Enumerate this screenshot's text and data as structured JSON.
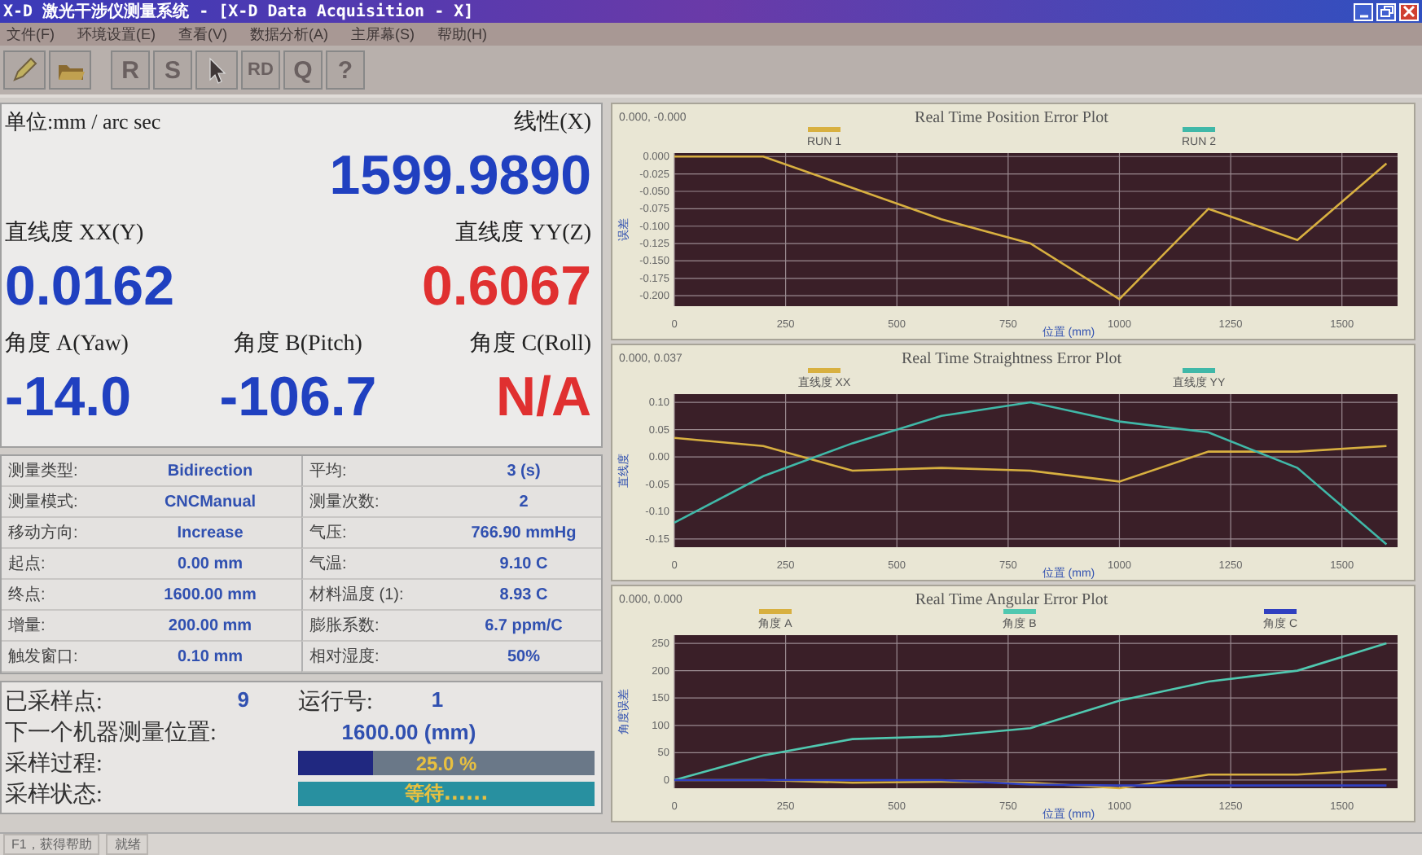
{
  "window": {
    "title": "X-D 激光干涉仪测量系统 - [X-D Data Acquisition - X]"
  },
  "menu": [
    "文件(F)",
    "环境设置(E)",
    "查看(V)",
    "数据分析(A)",
    "主屏幕(S)",
    "帮助(H)"
  ],
  "toolbar": [
    {
      "kind": "icon"
    },
    {
      "kind": "icon"
    },
    {
      "kind": "text",
      "label": "R"
    },
    {
      "kind": "text",
      "label": "S"
    },
    {
      "kind": "icon"
    },
    {
      "kind": "text",
      "label": "RD"
    },
    {
      "kind": "text",
      "label": "Q"
    },
    {
      "kind": "text",
      "label": "?"
    }
  ],
  "readouts": {
    "unit": "单位:mm / arc sec",
    "items": [
      {
        "label": "线性(X)",
        "value": "1599.9890",
        "color": "#2040c0"
      },
      {
        "label": "直线度 XX(Y)",
        "value": "0.0162",
        "color": "#2040c0"
      },
      {
        "label": "直线度 YY(Z)",
        "value": "0.6067",
        "color": "#e03030"
      },
      {
        "label": "角度 A(Yaw)",
        "value": "-14.0",
        "color": "#2040c0"
      },
      {
        "label": "角度 B(Pitch)",
        "value": "-106.7",
        "color": "#2040c0"
      },
      {
        "label": "角度 C(Roll)",
        "value": "N/A",
        "color": "#e03030"
      }
    ]
  },
  "params": [
    {
      "left": {
        "label": "测量类型:",
        "value": "Bidirection"
      },
      "right": {
        "label": "平均:",
        "value": "3 (s)"
      }
    },
    {
      "left": {
        "label": "测量模式:",
        "value": "CNCManual"
      },
      "right": {
        "label": "测量次数:",
        "value": "2"
      }
    },
    {
      "left": {
        "label": "移动方向:",
        "value": "Increase"
      },
      "right": {
        "label": "气压:",
        "value": "766.90 mmHg"
      }
    },
    {
      "left": {
        "label": "起点:",
        "value": "0.00 mm"
      },
      "right": {
        "label": "气温:",
        "value": "9.10  C"
      }
    },
    {
      "left": {
        "label": "终点:",
        "value": "1600.00 mm"
      },
      "right": {
        "label": "材料温度 (1):",
        "value": "8.93  C"
      }
    },
    {
      "left": {
        "label": "增量:",
        "value": "200.00 mm"
      },
      "right": {
        "label": "膨胀系数:",
        "value": "6.7  ppm/C"
      }
    },
    {
      "left": {
        "label": "触发窗口:",
        "value": "0.10 mm"
      },
      "right": {
        "label": "相对湿度:",
        "value": "50%"
      }
    }
  ],
  "status": {
    "samples_label": "已采样点:",
    "samples_value": "9",
    "run_label": "运行号:",
    "run_value": "1",
    "next_label": "下一个机器测量位置:",
    "next_value": "1600.00 (mm)",
    "progress": {
      "label": "采样过程:",
      "level": 0.25,
      "text": "25.0 %"
    },
    "state": {
      "label": "采样状态:",
      "text": "等待......"
    }
  },
  "charts": [
    {
      "coords": "0.000, -0.000",
      "chart_data": {
        "type": "line",
        "title": "Real Time Position Error Plot",
        "xlabel": "位置 (mm)",
        "ylabel": "误差",
        "x": [
          0,
          200,
          400,
          600,
          800,
          1000,
          1200,
          1400,
          1600
        ],
        "series": [
          {
            "name": "RUN 1",
            "color": "#d8b040",
            "values": [
              0.0,
              0.0,
              -0.045,
              -0.09,
              -0.125,
              -0.205,
              -0.075,
              -0.12,
              -0.01
            ]
          },
          {
            "name": "RUN 2",
            "color": "#40b8a8",
            "values": [
              null,
              null,
              null,
              null,
              null,
              null,
              null,
              null,
              null
            ]
          }
        ],
        "grid": true,
        "legend": true,
        "xlim": [
          0,
          1625
        ],
        "ylim": [
          -0.215,
          0.005
        ],
        "xticks": [
          0,
          250,
          500,
          750,
          1000,
          1250,
          1500
        ],
        "yticks": [
          {
            "value": 0,
            "label": "0.000"
          },
          {
            "value": -0.025,
            "label": "-0.025"
          },
          {
            "value": -0.05,
            "label": "-0.050"
          },
          {
            "value": -0.075,
            "label": "-0.075"
          },
          {
            "value": -0.1,
            "label": "-0.100"
          },
          {
            "value": -0.125,
            "label": "-0.125"
          },
          {
            "value": -0.15,
            "label": "-0.150"
          },
          {
            "value": -0.175,
            "label": "-0.175"
          },
          {
            "value": -0.2,
            "label": "-0.200"
          }
        ]
      }
    },
    {
      "coords": "0.000, 0.037",
      "chart_data": {
        "type": "line",
        "title": "Real Time Straightness Error Plot",
        "xlabel": "位置 (mm)",
        "ylabel": "直线度",
        "x": [
          0,
          200,
          400,
          600,
          800,
          1000,
          1200,
          1400,
          1600
        ],
        "series": [
          {
            "name": "直线度 XX",
            "color": "#d8b040",
            "values": [
              0.035,
              0.02,
              -0.025,
              -0.02,
              -0.025,
              -0.045,
              0.01,
              0.01,
              0.02
            ]
          },
          {
            "name": "直线度 YY",
            "color": "#40b8a8",
            "values": [
              -0.12,
              -0.035,
              0.025,
              0.075,
              0.1,
              0.065,
              0.045,
              -0.02,
              -0.16
            ]
          }
        ],
        "grid": true,
        "legend": true,
        "xlim": [
          0,
          1625
        ],
        "ylim": [
          -0.165,
          0.115
        ],
        "xticks": [
          0,
          250,
          500,
          750,
          1000,
          1250,
          1500
        ],
        "yticks": [
          {
            "value": 0.1,
            "label": "0.10"
          },
          {
            "value": 0.05,
            "label": "0.05"
          },
          {
            "value": 0,
            "label": "0.00"
          },
          {
            "value": -0.05,
            "label": "-0.05"
          },
          {
            "value": -0.1,
            "label": "-0.10"
          },
          {
            "value": -0.15,
            "label": "-0.15"
          }
        ]
      }
    },
    {
      "coords": "0.000, 0.000",
      "chart_data": {
        "type": "line",
        "title": "Real Time Angular Error Plot",
        "xlabel": "位置 (mm)",
        "ylabel": "角度误差",
        "x": [
          0,
          200,
          400,
          600,
          800,
          1000,
          1200,
          1400,
          1600
        ],
        "series": [
          {
            "name": "角度 A",
            "color": "#d8b040",
            "values": [
              0,
              0,
              -5,
              -3,
              -5,
              -15,
              10,
              10,
              20
            ]
          },
          {
            "name": "角度 B",
            "color": "#50c8b0",
            "values": [
              0,
              45,
              75,
              80,
              95,
              145,
              180,
              200,
              250
            ]
          },
          {
            "name": "角度 C",
            "color": "#3040c0",
            "values": [
              0,
              0,
              0,
              0,
              -8,
              -10,
              -10,
              -10,
              -10
            ]
          }
        ],
        "grid": true,
        "legend": true,
        "xlim": [
          0,
          1625
        ],
        "ylim": [
          -15,
          265
        ],
        "xticks": [
          0,
          250,
          500,
          750,
          1000,
          1250,
          1500
        ],
        "yticks": [
          0,
          50,
          100,
          150,
          200,
          250
        ]
      }
    }
  ],
  "status_bar": [
    "F1，获得帮助",
    "就绪"
  ]
}
